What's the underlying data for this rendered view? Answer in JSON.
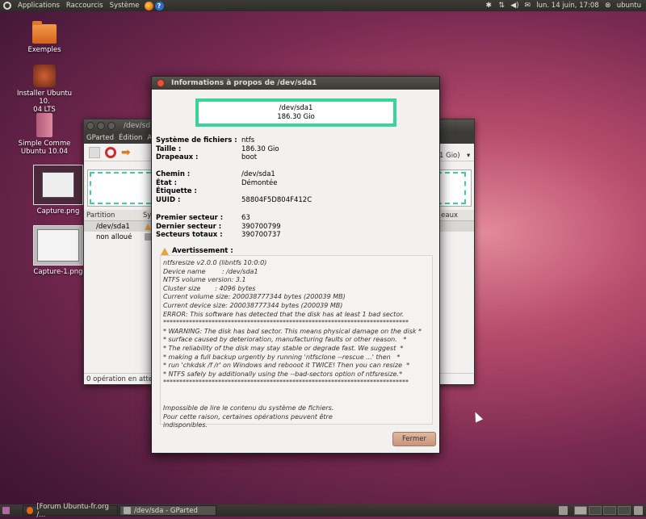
{
  "top_panel": {
    "menus": [
      "Applications",
      "Raccourcis",
      "Système"
    ],
    "clock": "lun. 14 juin, 17:08",
    "user": "ubuntu"
  },
  "desktop": {
    "icons": [
      "Exemples",
      "Installer Ubuntu 10.\n04 LTS",
      "Simple Comme\nUbuntu 10.04",
      "Capture.png",
      "Capture-1.png"
    ]
  },
  "gparted": {
    "title": "/dev/sd",
    "menus": [
      "GParted",
      "Édition",
      "A"
    ],
    "columns": [
      "Partition",
      "Sy"
    ],
    "rows": [
      {
        "partition": "/dev/sda1",
        "selected": true
      },
      {
        "partition": "non alloué",
        "selected": false
      }
    ],
    "right_size": "1 Gio)",
    "right_col": "eaux",
    "status": "0 opération en atten"
  },
  "dialog": {
    "title": "Informations à propos de /dev/sda1",
    "partition_name": "/dev/sda1",
    "partition_size": "186.30 Gio",
    "fields": [
      {
        "k": "Système de fichiers :",
        "v": "ntfs"
      },
      {
        "k": "Taille :",
        "v": "186.30 Gio"
      },
      {
        "k": "Drapeaux :",
        "v": "boot"
      },
      {
        "k": "Chemin :",
        "v": "/dev/sda1"
      },
      {
        "k": "État :",
        "v": "Démontée"
      },
      {
        "k": "Étiquette :",
        "v": ""
      },
      {
        "k": "UUID :",
        "v": "58804F5D804F412C"
      },
      {
        "k": "Premier secteur :",
        "v": "63"
      },
      {
        "k": "Dernier secteur :",
        "v": "390700799"
      },
      {
        "k": "Secteurs totaux :",
        "v": "390700737"
      }
    ],
    "warning_title": "Avertissement :",
    "warning_text": "ntfsresize v2.0.0 (libntfs 10:0:0)\nDevice name        : /dev/sda1\nNTFS volume version: 3.1\nCluster size       : 4096 bytes\nCurrent volume size: 200038777344 bytes (200039 MB)\nCurrent device size: 200038777344 bytes (200039 MB)\nERROR: This software has detected that the disk has at least 1 bad sector.\n****************************************************************************\n* WARNING: The disk has bad sector. This means physical damage on the disk *\n* surface caused by deterioration, manufacturing faults or other reason.   *\n* The reliability of the disk may stay stable or degrade fast. We suggest  *\n* making a full backup urgently by running 'ntfsclone --rescue ...' then   *\n* run 'chkdsk /f /r' on Windows and rebooot it TWICE! Then you can resize  *\n* NTFS safely by additionally using the --bad-sectors option of ntfsresize.*\n****************************************************************************\n\n\nImpossible de lire le contenu du système de fichiers.\nPour cette raison, certaines opérations peuvent être\nindisponibles.",
    "close_label": "Fermer"
  },
  "bottom_panel": {
    "tasks": [
      "[Forum Ubuntu-fr.org /...",
      "/dev/sda - GParted"
    ]
  }
}
